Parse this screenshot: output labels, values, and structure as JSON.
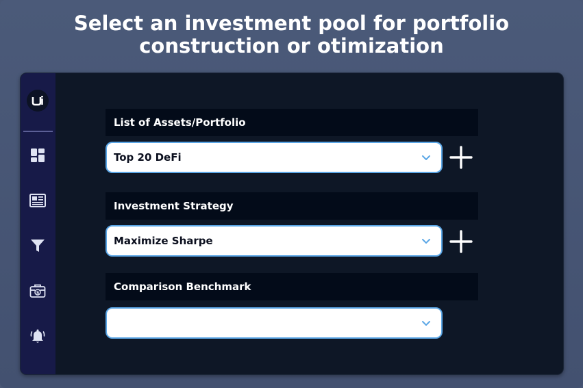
{
  "headline": {
    "line1": "Select an investment pool for portfolio",
    "line2": "construction or otimization"
  },
  "sidebar": {
    "logo_text": "ui",
    "items": [
      {
        "icon": "dashboard-icon"
      },
      {
        "icon": "news-icon"
      },
      {
        "icon": "filter-icon"
      },
      {
        "icon": "briefcase-dollar-icon"
      },
      {
        "icon": "alarm-bell-icon"
      }
    ]
  },
  "form": {
    "assets": {
      "label": "List of Assets/Portfolio",
      "value": "Top 20 DeFi"
    },
    "strategy": {
      "label": "Investment Strategy",
      "value": "Maximize Sharpe"
    },
    "benchmark": {
      "label": "Comparison Benchmark",
      "value": ""
    }
  },
  "colors": {
    "page_bg": "#4a5876",
    "app_bg": "#0e1726",
    "sidebar_bg": "#171a48",
    "label_bg": "#030b19",
    "select_border": "#5aa6e6",
    "chevron": "#5aa6e6"
  }
}
